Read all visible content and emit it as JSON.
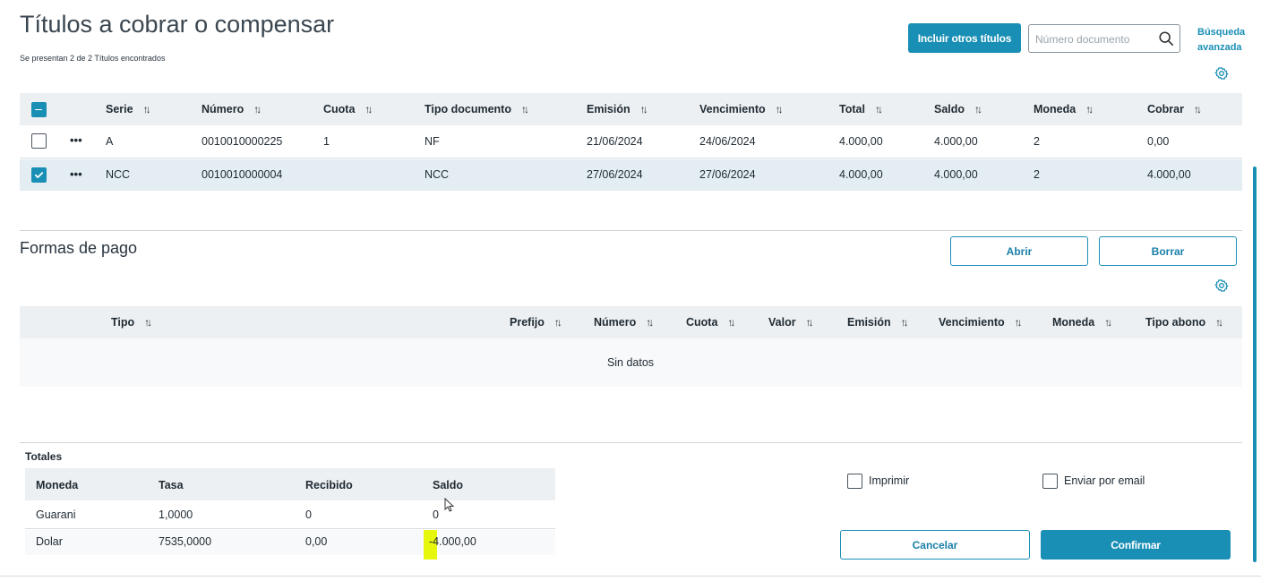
{
  "header": {
    "title": "Títulos a cobrar o compensar",
    "subtitle": "Se presentan 2 de 2 Títulos encontrados",
    "include_button": "Incluir otros títulos",
    "search_placeholder": "Número documento",
    "advanced_search": "Búsqueda avanzada"
  },
  "titles_table": {
    "columns": [
      "Serie",
      "Número",
      "Cuota",
      "Tipo documento",
      "Emisión",
      "Vencimiento",
      "Total",
      "Saldo",
      "Moneda",
      "Cobrar"
    ],
    "rows": [
      {
        "selected": false,
        "serie": "A",
        "numero": "0010010000225",
        "cuota": "1",
        "tipo": "NF",
        "emision": "21/06/2024",
        "vencimiento": "24/06/2024",
        "total": "4.000,00",
        "saldo": "4.000,00",
        "moneda": "2",
        "cobrar": "0,00"
      },
      {
        "selected": true,
        "serie": "NCC",
        "numero": "0010010000004",
        "cuota": "",
        "tipo": "NCC",
        "emision": "27/06/2024",
        "vencimiento": "27/06/2024",
        "total": "4.000,00",
        "saldo": "4.000,00",
        "moneda": "2",
        "cobrar": "4.000,00"
      }
    ]
  },
  "payment": {
    "title": "Formas de pago",
    "open_button": "Abrir",
    "delete_button": "Borrar",
    "columns": [
      "Tipo",
      "Prefijo",
      "Número",
      "Cuota",
      "Valor",
      "Emisión",
      "Vencimiento",
      "Moneda",
      "Tipo abono"
    ],
    "empty_text": "Sin datos"
  },
  "totals": {
    "title": "Totales",
    "columns": [
      "Moneda",
      "Tasa",
      "Recibido",
      "Saldo"
    ],
    "rows": [
      {
        "moneda": "Guarani",
        "tasa": "1,0000",
        "recibido": "0",
        "saldo": "0"
      },
      {
        "moneda": "Dolar",
        "tasa": "7535,0000",
        "recibido": "0,00",
        "saldo": "-4.000,00"
      }
    ]
  },
  "options": {
    "print_label": "Imprimir",
    "email_label": "Enviar por email"
  },
  "footer": {
    "cancel_button": "Cancelar",
    "confirm_button": "Confirmar"
  },
  "colors": {
    "accent": "#1a8fb5",
    "header_bg": "#edf0f2",
    "selected_row": "#e3edf2",
    "highlight": "#e7f70c"
  }
}
